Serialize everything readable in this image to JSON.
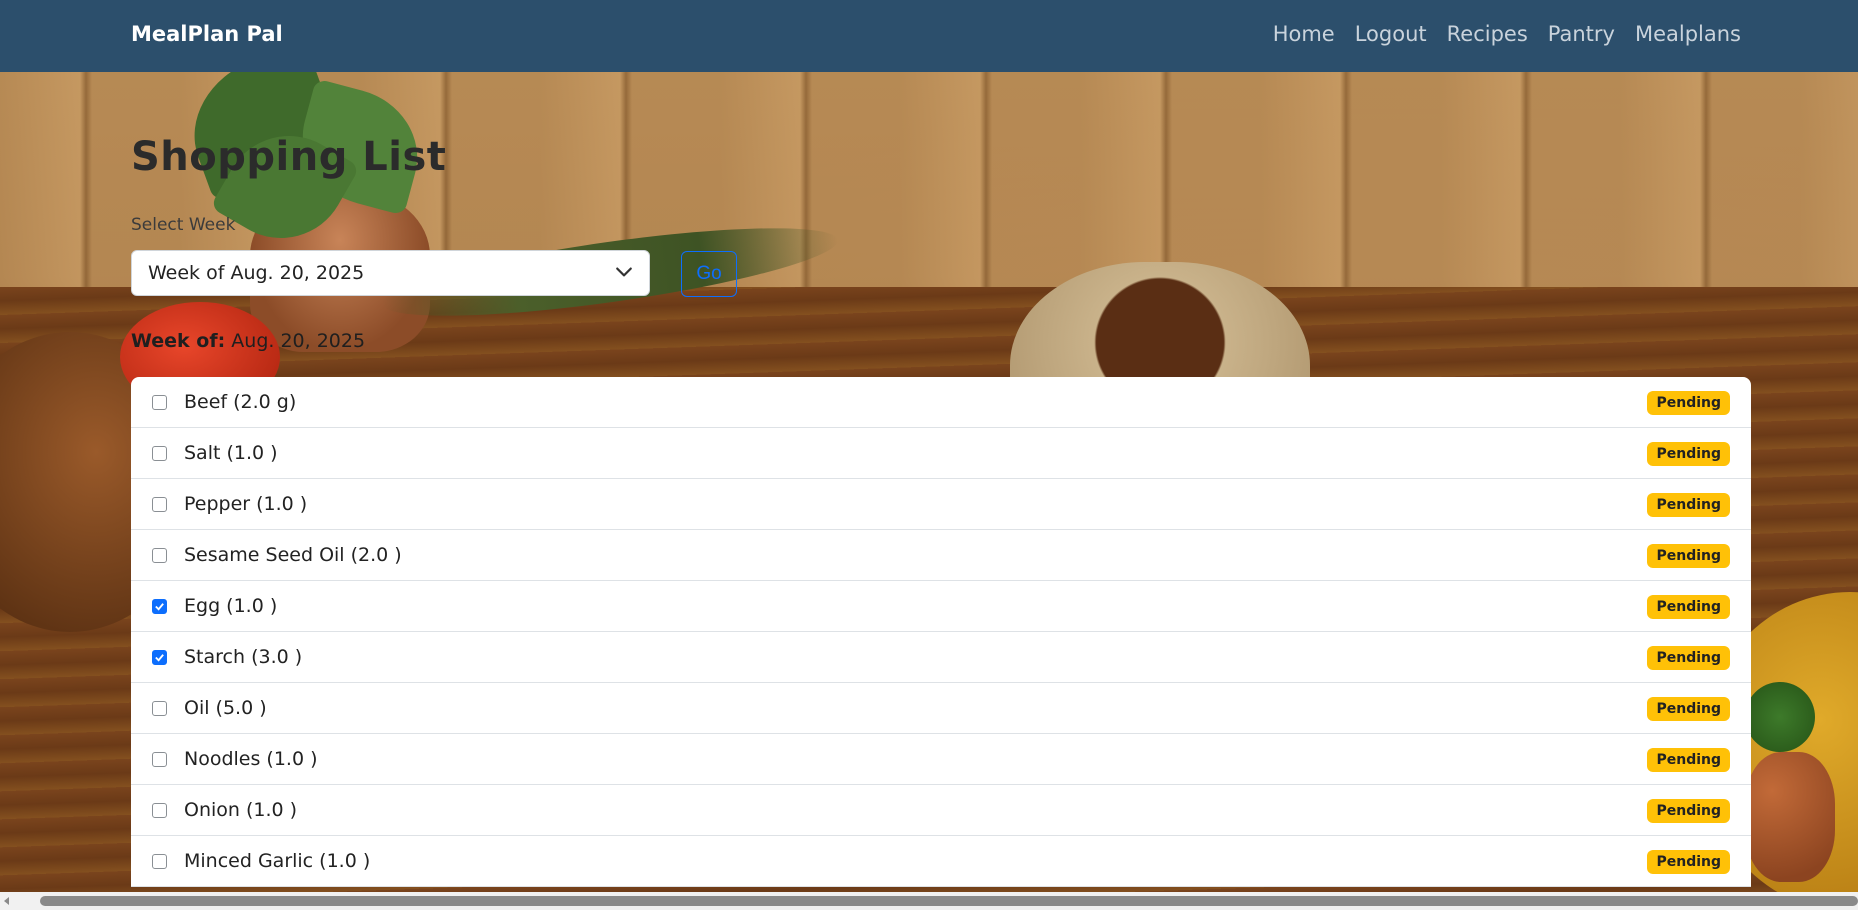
{
  "navbar": {
    "brand": "MealPlan Pal",
    "links": [
      "Home",
      "Logout",
      "Recipes",
      "Pantry",
      "Mealplans"
    ]
  },
  "page": {
    "title": "Shopping List",
    "select_label": "Select Week",
    "selected_week": "Week of Aug. 20, 2025",
    "go_label": "Go",
    "week_of_label": "Week of:",
    "week_of_value": "Aug. 20, 2025"
  },
  "items": [
    {
      "label": "Beef (2.0 g)",
      "checked": false,
      "status": "Pending"
    },
    {
      "label": "Salt (1.0 )",
      "checked": false,
      "status": "Pending"
    },
    {
      "label": "Pepper (1.0 )",
      "checked": false,
      "status": "Pending"
    },
    {
      "label": "Sesame Seed Oil (2.0 )",
      "checked": false,
      "status": "Pending"
    },
    {
      "label": "Egg (1.0 )",
      "checked": true,
      "status": "Pending"
    },
    {
      "label": "Starch (3.0 )",
      "checked": true,
      "status": "Pending"
    },
    {
      "label": "Oil (5.0 )",
      "checked": false,
      "status": "Pending"
    },
    {
      "label": "Noodles (1.0 )",
      "checked": false,
      "status": "Pending"
    },
    {
      "label": "Onion (1.0 )",
      "checked": false,
      "status": "Pending"
    },
    {
      "label": "Minced Garlic (1.0 )",
      "checked": false,
      "status": "Pending"
    }
  ],
  "colors": {
    "navbar": "#2c4f6c",
    "accent": "#0d6efd",
    "badge": "#ffc107"
  },
  "icons": {
    "select": "chevron-down-icon",
    "checkbox": "check-icon",
    "scroll": "scroll-left-arrow-icon"
  }
}
